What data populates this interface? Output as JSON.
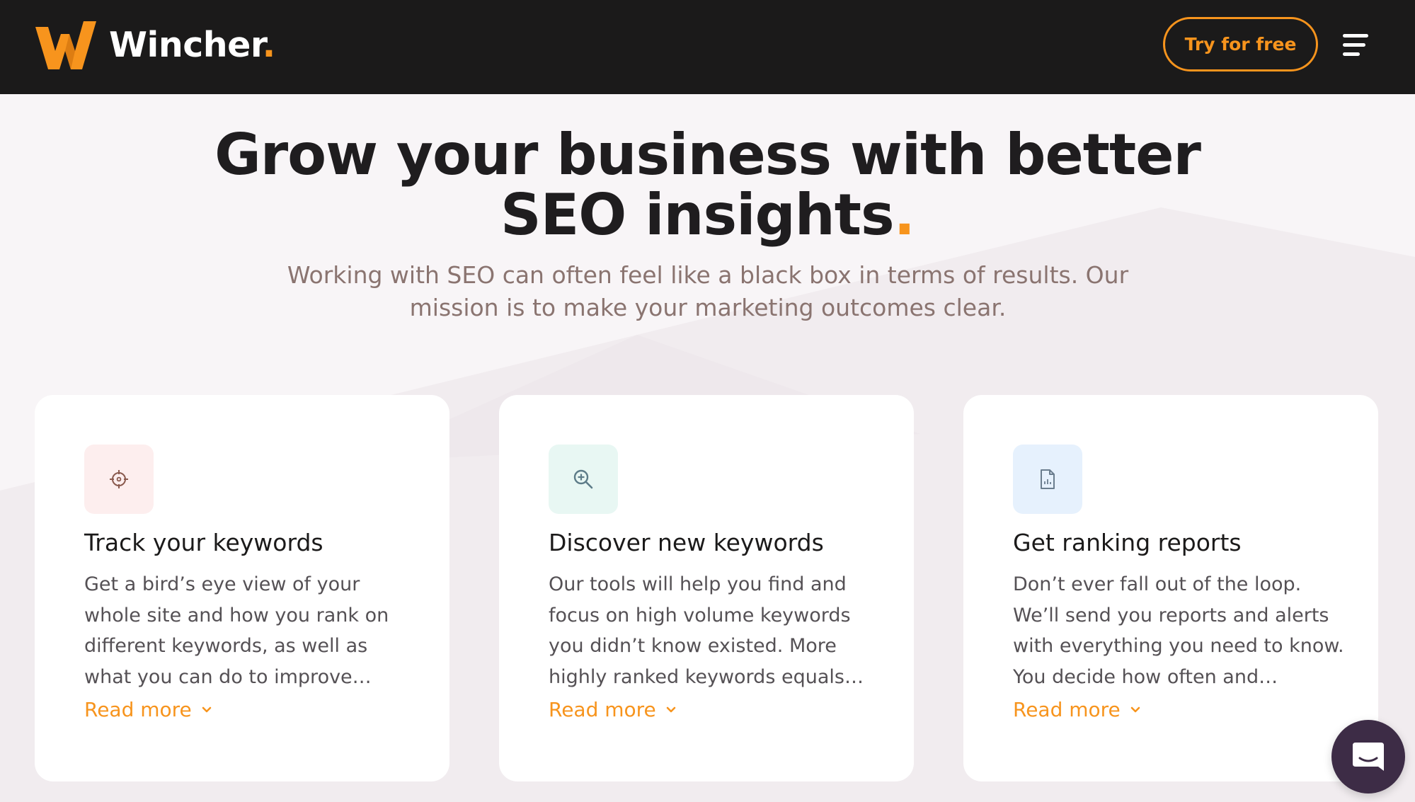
{
  "brand": {
    "name": "Wincher",
    "dot": ".",
    "accent_color": "#f7941d",
    "header_bg": "#1b1a1a"
  },
  "header": {
    "cta_label": "Try for free",
    "menu_icon": "hamburger-menu-icon"
  },
  "hero": {
    "title_line1": "Grow your business with better",
    "title_line2": "SEO insights",
    "title_dot": ".",
    "subtitle": "Working with SEO can often feel like a black box in terms of results. Our mission is to make your marketing outcomes clear."
  },
  "cards": [
    {
      "icon": "crosshair-target-icon",
      "icon_bg": "#fdeeee",
      "title": "Track your keywords",
      "text": "Get a bird’s eye view of your whole site and how you rank on different keywords, as well as what you can do to improve…",
      "link": "Read more"
    },
    {
      "icon": "search-zoom-icon",
      "icon_bg": "#e8f7f3",
      "title": "Discover new keywords",
      "text": "Our tools will help you find and focus on high volume keywords you didn’t know existed. More highly ranked keywords equals…",
      "link": "Read more"
    },
    {
      "icon": "report-document-icon",
      "icon_bg": "#e6f1fd",
      "title": "Get ranking reports",
      "text": "Don’t ever fall out of the loop. We’ll send you reports and alerts with everything you need to know. You decide how often and…",
      "link": "Read more"
    }
  ],
  "chat": {
    "icon": "chat-bubble-icon"
  }
}
